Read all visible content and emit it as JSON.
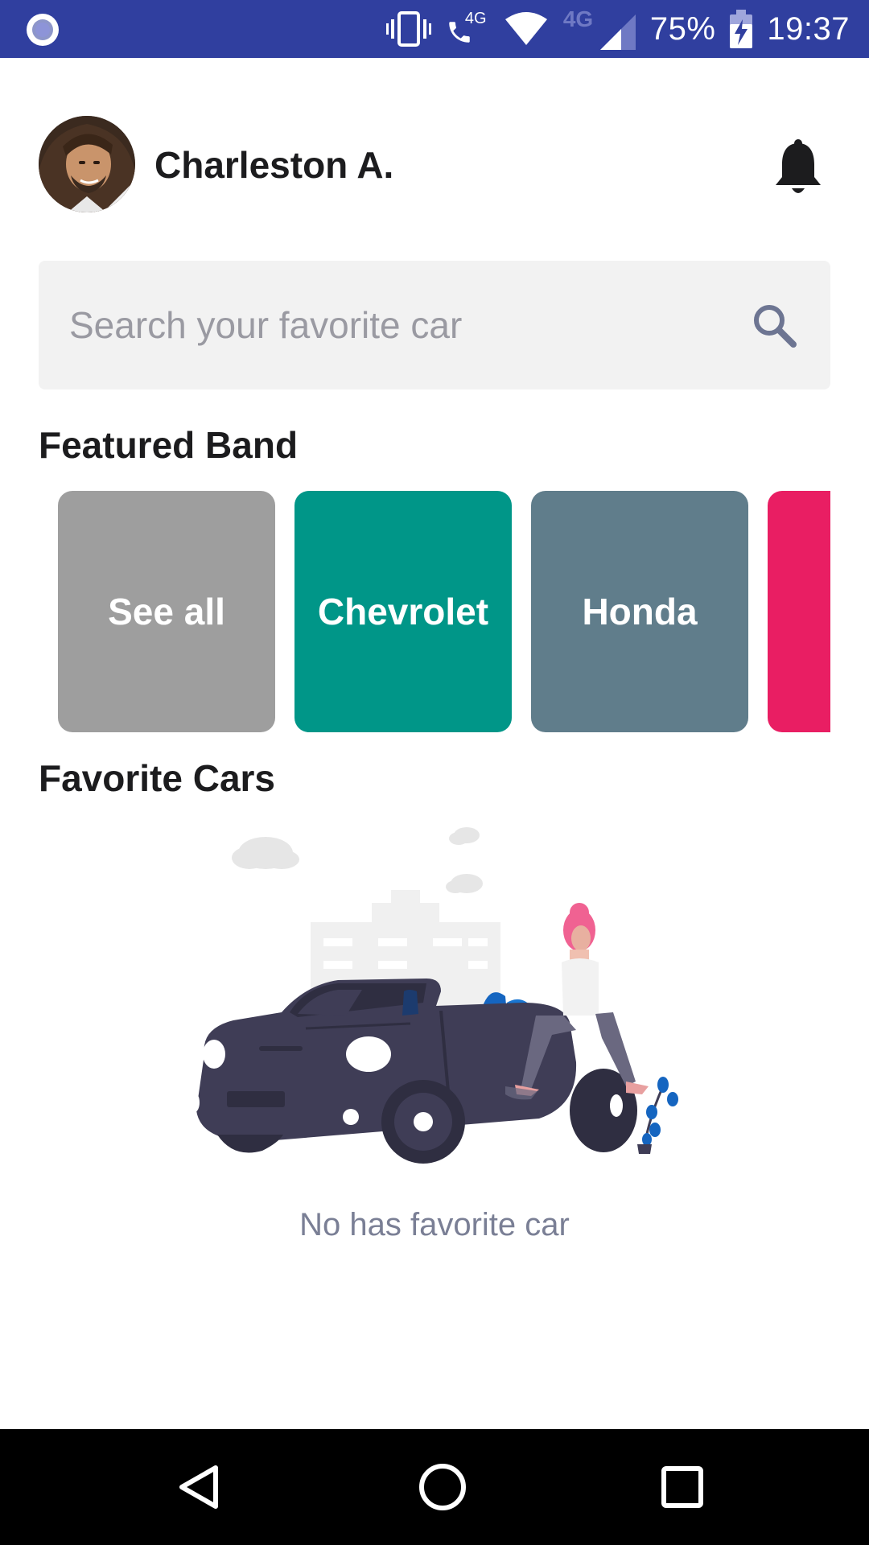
{
  "status_bar": {
    "network_label_1": "4G",
    "network_label_2": "4G",
    "battery": "75%",
    "time": "19:37"
  },
  "header": {
    "user_name": "Charleston A.",
    "avatar_icon": "user-avatar",
    "notification_icon": "bell-icon"
  },
  "search": {
    "placeholder": "Search your favorite car",
    "value": "",
    "icon": "search-icon"
  },
  "featured": {
    "title": "Featured Band",
    "brands": [
      {
        "label": "See all",
        "color": "#9e9e9e"
      },
      {
        "label": "Chevrolet",
        "color": "#009688"
      },
      {
        "label": "Honda",
        "color": "#607d8b"
      },
      {
        "label": "",
        "color": "#e91e63"
      }
    ]
  },
  "favorites": {
    "title": "Favorite Cars",
    "empty_message": "No has favorite car"
  },
  "navigation": {
    "back_icon": "back-triangle-icon",
    "home_icon": "home-circle-icon",
    "recents_icon": "recents-square-icon"
  },
  "colors": {
    "status_bar": "#303f9f",
    "search_bg": "#f2f2f2",
    "text_primary": "#1c1c1e",
    "text_muted": "#7a7f95"
  }
}
